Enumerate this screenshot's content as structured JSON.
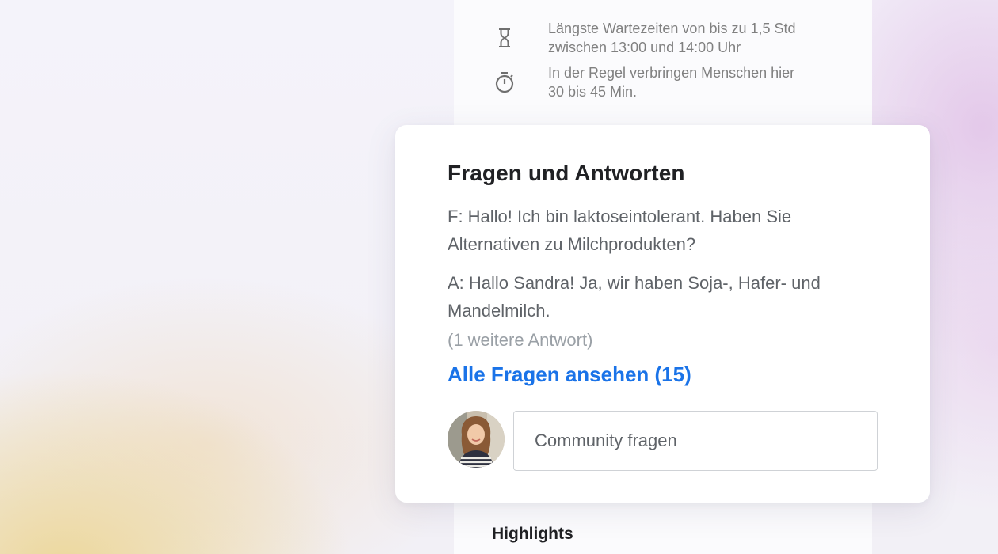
{
  "panel": {
    "wait_times": {
      "icon": "hourglass-icon",
      "text_line1": "Längste Wartezeiten von bis zu 1,5 Std",
      "text_line2": "zwischen 13:00 und 14:00 Uhr"
    },
    "visit_duration": {
      "icon": "stopwatch-icon",
      "text_line1": "In der Regel verbringen Menschen hier",
      "text_line2": "30 bis 45 Min."
    },
    "highlights_heading": "Highlights"
  },
  "qa_card": {
    "title": "Fragen und Antworten",
    "question_line1": "F: Hallo! Ich bin laktoseintolerant. Haben Sie",
    "question_line2": "Alternativen zu Milchprodukten?",
    "answer_line1": "A: Hallo Sandra! Ja, wir haben Soja-, Hafer- und",
    "answer_line2": "Mandelmilch.",
    "more_answers": "(1 weitere Antwort)",
    "all_questions_link": "Alle Fragen ansehen (15)",
    "ask_input_placeholder": "Community fragen",
    "link_color": "#1a73e8"
  }
}
